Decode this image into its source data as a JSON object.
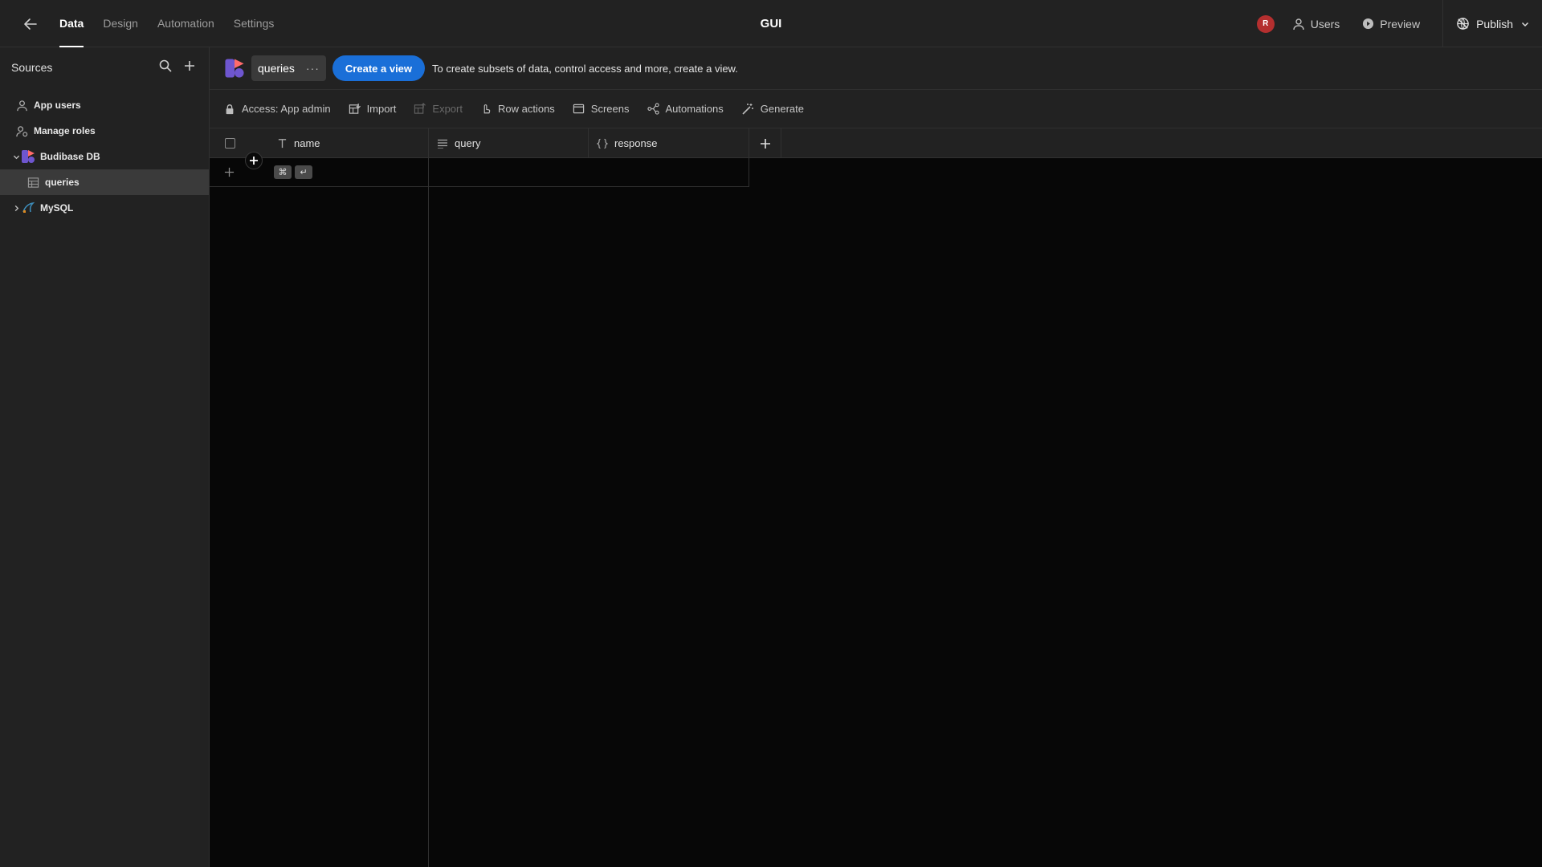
{
  "app": {
    "title": "GUI"
  },
  "nav": {
    "tabs": [
      "Data",
      "Design",
      "Automation",
      "Settings"
    ],
    "active": "Data"
  },
  "header_right": {
    "avatar_initial": "R",
    "users_label": "Users",
    "preview_label": "Preview",
    "publish_label": "Publish"
  },
  "sidebar": {
    "title": "Sources",
    "items": [
      {
        "label": "App users",
        "icon": "user-icon"
      },
      {
        "label": "Manage roles",
        "icon": "roles-icon"
      },
      {
        "label": "Budibase DB",
        "icon": "budibase-logo-icon",
        "expanded": true
      },
      {
        "label": "queries",
        "icon": "table-icon",
        "selected": true
      },
      {
        "label": "MySQL",
        "icon": "mysql-icon",
        "expanded": false
      }
    ]
  },
  "table_tab": {
    "name": "queries",
    "more": "···"
  },
  "cta": {
    "label": "Create a view",
    "hint": "To create subsets of data, control access and more, create a view."
  },
  "toolbar": {
    "access": "Access: App admin",
    "import": "Import",
    "export": "Export",
    "row_actions": "Row actions",
    "screens": "Screens",
    "automations": "Automations",
    "generate": "Generate"
  },
  "columns": [
    {
      "name": "name",
      "type": "text"
    },
    {
      "name": "query",
      "type": "longform"
    },
    {
      "name": "response",
      "type": "json"
    }
  ],
  "shortcut": {
    "key1": "⌘",
    "key2": "↵"
  },
  "colors": {
    "accent": "#1a6fd8",
    "avatar": "#b42f2f",
    "background": "#070707",
    "panel": "#222222"
  }
}
